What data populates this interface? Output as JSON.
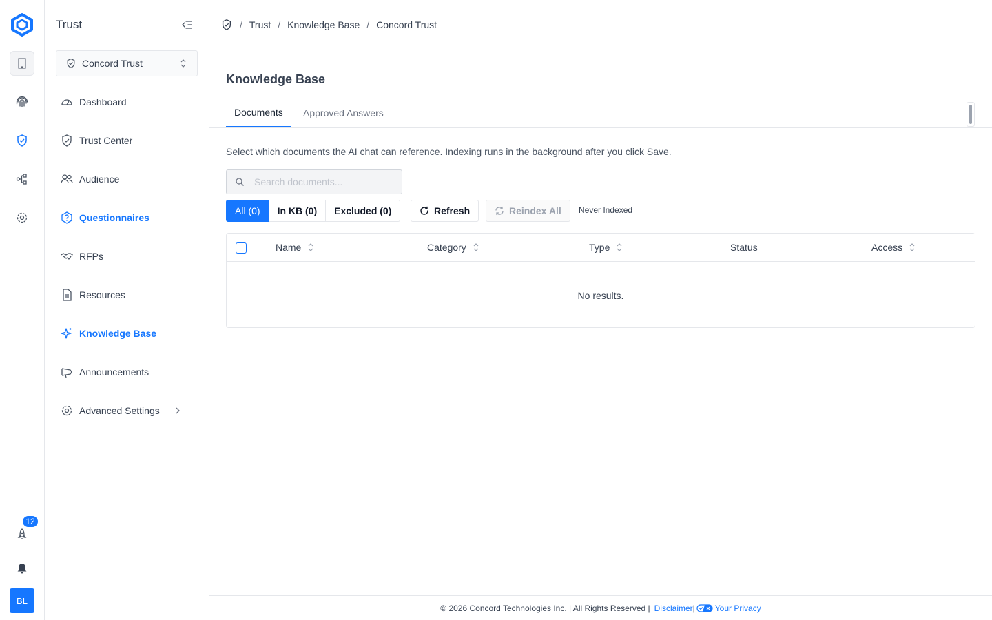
{
  "app": {
    "title": "Trust"
  },
  "rail": {
    "badge_count": "12",
    "avatar_initials": "BL"
  },
  "workspace": {
    "selected": "Concord Trust"
  },
  "nav": {
    "items": [
      {
        "label": "Dashboard",
        "icon": "gauge-icon"
      },
      {
        "label": "Trust Center",
        "icon": "shield-check-icon"
      },
      {
        "label": "Audience",
        "icon": "users-icon"
      },
      {
        "label": "Questionnaires",
        "icon": "question-circle-icon",
        "active": true
      },
      {
        "label": "RFPs",
        "icon": "handshake-icon"
      },
      {
        "label": "Resources",
        "icon": "document-icon"
      },
      {
        "label": "Knowledge Base",
        "icon": "sparkles-icon",
        "active": true
      },
      {
        "label": "Announcements",
        "icon": "megaphone-icon"
      },
      {
        "label": "Advanced Settings",
        "icon": "gear-icon"
      }
    ]
  },
  "breadcrumb": {
    "items": [
      "Trust",
      "Knowledge Base",
      "Concord Trust"
    ],
    "separator": "/"
  },
  "page": {
    "title": "Knowledge Base",
    "tabs": [
      "Documents",
      "Approved Answers"
    ],
    "description": "Select which documents the AI chat can reference. Indexing runs in the background after you click Save."
  },
  "search": {
    "placeholder": "Search documents...",
    "value": ""
  },
  "filters": {
    "all": "All (0)",
    "in_kb": "In KB (0)",
    "excluded": "Excluded (0)"
  },
  "actions": {
    "refresh": "Refresh",
    "reindex": "Reindex All",
    "index_status": "Never Indexed"
  },
  "table": {
    "columns": [
      "Name",
      "Category",
      "Type",
      "Status",
      "Access"
    ],
    "rows": [],
    "empty_text": "No results."
  },
  "footer": {
    "copyright": "© 2026 Concord Technologies Inc. | All Rights Reserved |",
    "disclaimer": "Disclaimer",
    "privacy": "Your Privacy"
  },
  "colors": {
    "accent": "#1677ff",
    "border": "#e5e7eb",
    "text": "#374151"
  }
}
